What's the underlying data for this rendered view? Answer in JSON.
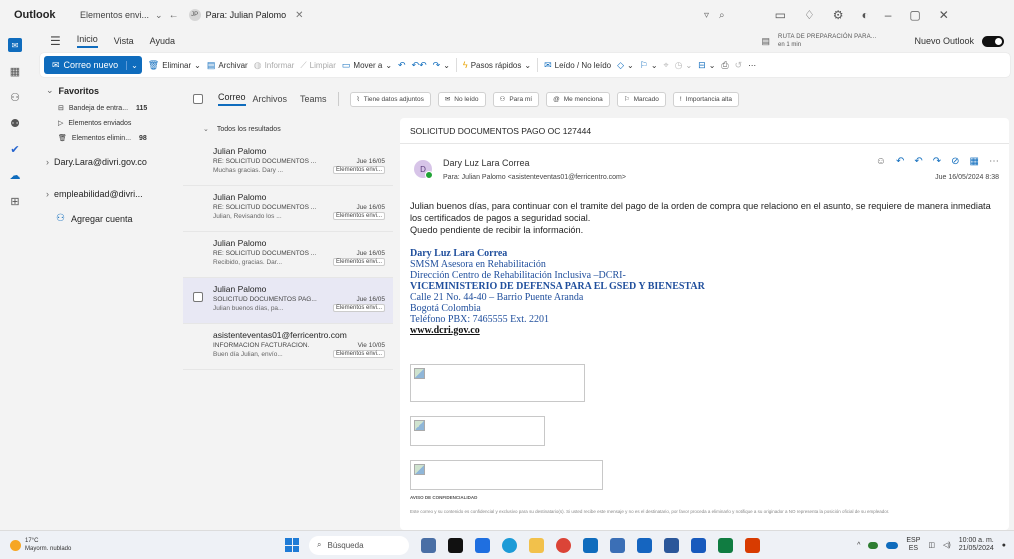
{
  "titlebar": {
    "app_name": "Outlook",
    "tab_label": "Elementos envi...",
    "address_avatar": "JP",
    "address_text": "Para: Julian Palomo",
    "address_close": "✕"
  },
  "ribbon_tabs": {
    "items": [
      "Inicio",
      "Vista",
      "Ayuda"
    ],
    "prep_title": "RUTA DE PREPARACIÓN PARA...",
    "prep_sub": "en 1 min",
    "nuevo_outlook": "Nuevo Outlook"
  },
  "toolbar": {
    "new_mail": "Correo nuevo",
    "eliminar": "Eliminar",
    "archivar": "Archivar",
    "informar": "Informar",
    "limpiar": "Limpiar",
    "mover": "Mover a",
    "pasos": "Pasos rápidos",
    "leido": "Leído / No leído"
  },
  "folders": {
    "favoritos": "Favoritos",
    "items": [
      {
        "label": "Bandeja de entra...",
        "count": "115"
      },
      {
        "label": "Elementos enviados",
        "count": ""
      },
      {
        "label": "Elementos elimin...",
        "count": "98"
      }
    ],
    "accounts": [
      "Dary.Lara@divri.gov.co",
      "empleabilidad@divri..."
    ],
    "add_account": "Agregar cuenta"
  },
  "filters": {
    "tabs": [
      "Correo",
      "Archivos",
      "Teams"
    ],
    "chips": [
      "Tiene datos adjuntos",
      "No leído",
      "Para mí",
      "Me menciona",
      "Marcado",
      "Importancia alta"
    ]
  },
  "list": {
    "header": "Todos los resultados",
    "messages": [
      {
        "from": "Julian Palomo",
        "subject": "RE: SOLICITUD DOCUMENTOS ...",
        "date": "Jue 16/05",
        "preview": "Muchas gracias. Dary ...",
        "folder": "Elementos envi..."
      },
      {
        "from": "Julian Palomo",
        "subject": "RE: SOLICITUD DOCUMENTOS ...",
        "date": "Jue 16/05",
        "preview": "Julian, Revisando los ...",
        "folder": "Elementos envi..."
      },
      {
        "from": "Julian Palomo",
        "subject": "RE: SOLICITUD DOCUMENTOS ...",
        "date": "Jue 16/05",
        "preview": "Recibido, gracias. Dar...",
        "folder": "Elementos envi..."
      },
      {
        "from": "Julian Palomo",
        "subject": "SOLICITUD DOCUMENTOS PAG...",
        "date": "Jue 16/05",
        "preview": "Julian buenos días, pa...",
        "folder": "Elementos envi..."
      },
      {
        "from": "asistenteventas01@ferricentro.com",
        "subject": "INFORMACION FACTURACION.",
        "date": "Vie 10/05",
        "preview": "Buen día Julian, envío...",
        "folder": "Elementos envi..."
      }
    ]
  },
  "reading": {
    "subject": "SOLICITUD DOCUMENTOS PAGO OC 127444",
    "avatar": "D",
    "sender_name": "Dary Luz Lara Correa",
    "to": "Para: Julian Palomo <asistenteventas01@ferricentro.com>",
    "date": "Jue 16/05/2024 8:38",
    "body_1": "Julian buenos días, para continuar con el tramite del pago de la orden de compra que relaciono en el asunto, se requiere de manera inmediata los certificados de pagos a seguridad social.",
    "body_2": "Quedo pendiente de recibir la información.",
    "sig_name": "Dary Luz Lara Correa",
    "sig_role": "SMSM Asesora en Rehabilitación",
    "sig_dept": "Dirección Centro de Rehabilitación Inclusiva –DCRI-",
    "sig_ministry": "VICEMINISTERIO DE DEFENSA PARA EL GSED Y BIENESTAR",
    "sig_address": "Calle 21 No. 44-40 – Barrio Puente Aranda",
    "sig_city": "Bogotá Colombia",
    "sig_phone": "Teléfono PBX: 7465555 Ext. 2201",
    "sig_web": "www.dcri.gov.co",
    "aviso_title": "AVISO DE CONFIDENCIALIDAD",
    "aviso_text": "Este correo y su contenido es confidencial y exclusivo para su destinatario(s). Si usted recibe este mensaje y no es el destinatario, por favor proceda a eliminarlo y notifique a su originador a NO representa la posición oficial de su empleador."
  },
  "taskbar": {
    "temp": "17°C",
    "weather": "Mayorm. nublado",
    "search": "Búsqueda",
    "lang_1": "ESP",
    "lang_2": "ES",
    "time": "10:00 a. m.",
    "date": "21/05/2024"
  },
  "colors": {
    "accent": "#0f6cbd",
    "selected_row": "#e8e8f4"
  }
}
